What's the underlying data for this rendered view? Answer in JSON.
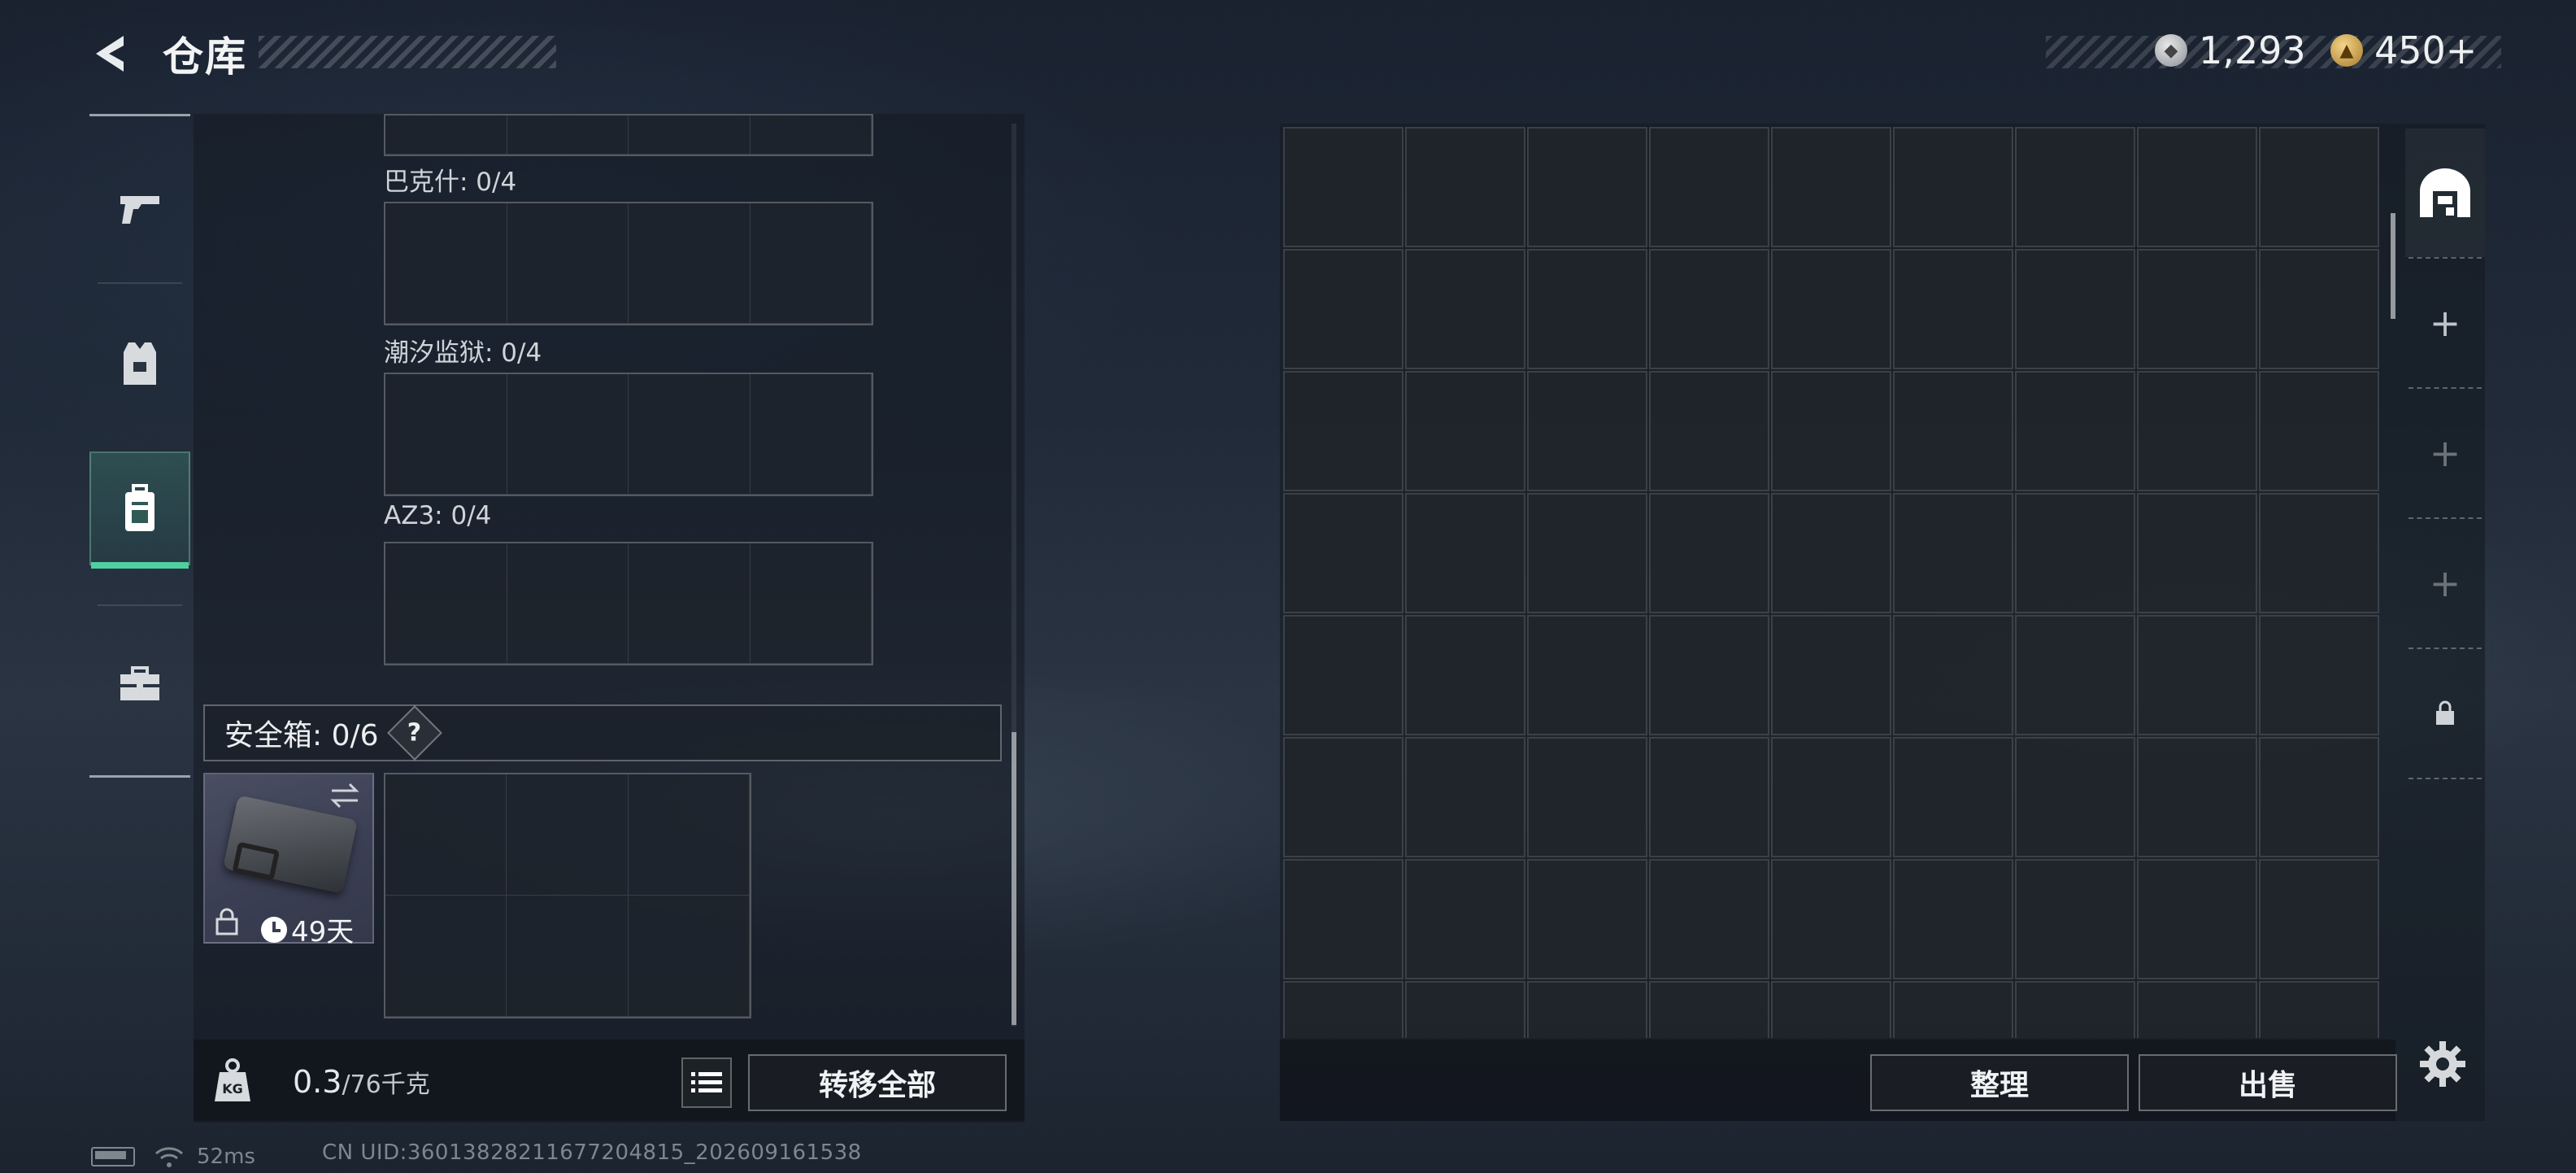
{
  "header": {
    "title": "仓库",
    "currency1": "1,293",
    "currency2": "450+"
  },
  "sidebar": {
    "items": [
      {
        "name": "weapons",
        "icon": "pistol-icon"
      },
      {
        "name": "armor",
        "icon": "vest-icon"
      },
      {
        "name": "containers",
        "icon": "backpack-icon",
        "active": true
      },
      {
        "name": "supplies",
        "icon": "toolbox-icon"
      }
    ]
  },
  "containers": {
    "label1": "巴克什: 0/4",
    "label2": "潮汐监狱: 0/4",
    "label3": "AZ3: 0/4"
  },
  "safebox": {
    "label": "安全箱: 0/6",
    "help": "?",
    "days": "49天"
  },
  "weight": {
    "current": "0.3",
    "max": "/76千克"
  },
  "buttons": {
    "transfer_all": "转移全部",
    "sort": "整理",
    "sell": "出售"
  },
  "tabs": {
    "plus1": "+",
    "plus2": "+",
    "plus3": "+"
  },
  "status": {
    "ping": "52ms",
    "uid": "CN UID:3601382821167720481​5_202609161538"
  }
}
